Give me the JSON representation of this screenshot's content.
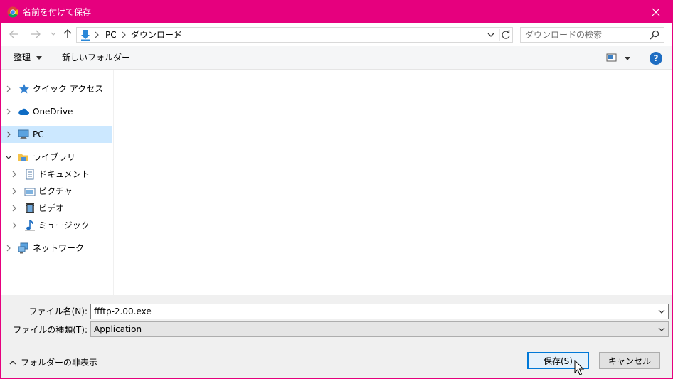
{
  "window": {
    "title": "名前を付けて保存",
    "app_icon": "chrome-icon",
    "accent": "#e6007e"
  },
  "nav": {
    "back_icon": "back-arrow-icon",
    "forward_icon": "forward-arrow-icon",
    "recent_icon": "chevron-down-icon",
    "up_icon": "up-arrow-icon"
  },
  "address": {
    "crumbs": [
      "PC",
      "ダウンロード"
    ],
    "folder_icon": "downloads-icon"
  },
  "search": {
    "placeholder": "ダウンロードの検索"
  },
  "toolbar": {
    "organize_label": "整理",
    "new_folder_label": "新しいフォルダー",
    "help_label": "?"
  },
  "sidebar": {
    "items": [
      {
        "label": "クイック アクセス",
        "icon": "star-icon",
        "level": 0,
        "expanded": false,
        "selected": false
      },
      {
        "label": "OneDrive",
        "icon": "cloud-icon",
        "level": 0,
        "expanded": false,
        "selected": false
      },
      {
        "label": "PC",
        "icon": "computer-icon",
        "level": 0,
        "expanded": false,
        "selected": true
      },
      {
        "label": "ライブラリ",
        "icon": "library-icon",
        "level": 0,
        "expanded": true,
        "selected": false
      },
      {
        "label": "ドキュメント",
        "icon": "document-icon",
        "level": 1,
        "expanded": false,
        "selected": false
      },
      {
        "label": "ピクチャ",
        "icon": "pictures-icon",
        "level": 1,
        "expanded": false,
        "selected": false
      },
      {
        "label": "ビデオ",
        "icon": "video-icon",
        "level": 1,
        "expanded": false,
        "selected": false
      },
      {
        "label": "ミュージック",
        "icon": "music-icon",
        "level": 1,
        "expanded": false,
        "selected": false
      },
      {
        "label": "ネットワーク",
        "icon": "network-icon",
        "level": 0,
        "expanded": false,
        "selected": false
      }
    ]
  },
  "form": {
    "filename_label": "ファイル名(N):",
    "filename_value": "ffftp-2.00.exe",
    "filetype_label": "ファイルの種類(T):",
    "filetype_value": "Application"
  },
  "footer": {
    "hide_folders_label": "フォルダーの非表示",
    "save_label": "保存(S)",
    "cancel_label": "キャンセル"
  }
}
